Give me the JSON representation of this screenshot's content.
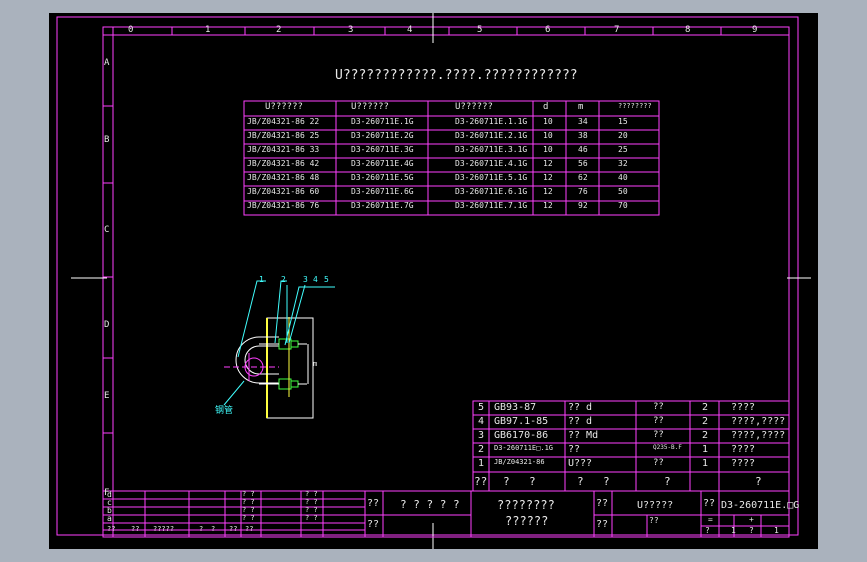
{
  "colors": {
    "bg": "#000000",
    "frame": "#ff00ff",
    "text": "#ffffff",
    "leader": "#00ffff",
    "viewport": "#aab2bd"
  },
  "zones_top": [
    "0",
    "1",
    "2",
    "3",
    "4",
    "5",
    "6",
    "7",
    "8",
    "9"
  ],
  "zones_left": [
    "A",
    "B",
    "C",
    "D",
    "E",
    "F"
  ],
  "title": "U????????????.????.????????????",
  "spec_table": {
    "headers": [
      "U??????",
      "U??????",
      "U??????",
      "d",
      "m",
      "????????"
    ],
    "rows": [
      [
        "JB/Z04321-86 22",
        "D3-260711E.1G",
        "D3-260711E.1.1G",
        "10",
        "34",
        "15"
      ],
      [
        "JB/Z04321-86 25",
        "D3-260711E.2G",
        "D3-260711E.2.1G",
        "10",
        "38",
        "20"
      ],
      [
        "JB/Z04321-86 33",
        "D3-260711E.3G",
        "D3-260711E.3.1G",
        "10",
        "46",
        "25"
      ],
      [
        "JB/Z04321-86 42",
        "D3-260711E.4G",
        "D3-260711E.4.1G",
        "12",
        "56",
        "32"
      ],
      [
        "JB/Z04321-86 48",
        "D3-260711E.5G",
        "D3-260711E.5.1G",
        "12",
        "62",
        "40"
      ],
      [
        "JB/Z04321-86 60",
        "D3-260711E.6G",
        "D3-260711E.6.1G",
        "12",
        "76",
        "50"
      ],
      [
        "JB/Z04321-86 76",
        "D3-260711E.7G",
        "D3-260711E.7.1G",
        "12",
        "92",
        "70"
      ]
    ]
  },
  "callouts": [
    "1",
    "2",
    "3",
    "4",
    "5"
  ],
  "drawing_label": "钢管",
  "dim_label": "m",
  "bom": {
    "rows": [
      [
        "5",
        "GB93-87",
        "?? d",
        "??",
        "2",
        "????"
      ],
      [
        "4",
        "GB97.1-85",
        "?? d",
        "??",
        "2",
        "????,????"
      ],
      [
        "3",
        "GB6170-86",
        "?? Md",
        "??",
        "2",
        "????,????"
      ],
      [
        "2",
        "D3-260711E□.1G",
        "??",
        "Q235-B.F",
        "1",
        "????"
      ],
      [
        "1",
        "JB/Z04321-86",
        "U???",
        "??",
        "1",
        "????"
      ]
    ],
    "header": [
      "??",
      "?",
      "?",
      "?",
      "?",
      "?",
      "?"
    ]
  },
  "title_block": {
    "rev_letters": [
      "d",
      "c",
      "b",
      "a"
    ],
    "marks": [
      "? ?",
      "? ?",
      "? ?",
      "? ?"
    ],
    "footer": [
      "??",
      "??",
      "?????",
      "?",
      "?",
      "??",
      "??"
    ],
    "design": "??",
    "check": "??",
    "company": "? ? ? ? ?",
    "name_line1": "????????",
    "name_line2": "??????",
    "stage": "??",
    "scale": "??",
    "material": "U?????",
    "weight": "??",
    "drawing_no_label": "??",
    "drawing_no": "D3-260711E.□G",
    "sheet": "1",
    "sheets": "1",
    "equal": "=",
    "plus": "+",
    "total_label": "?",
    "page_label": "?"
  }
}
